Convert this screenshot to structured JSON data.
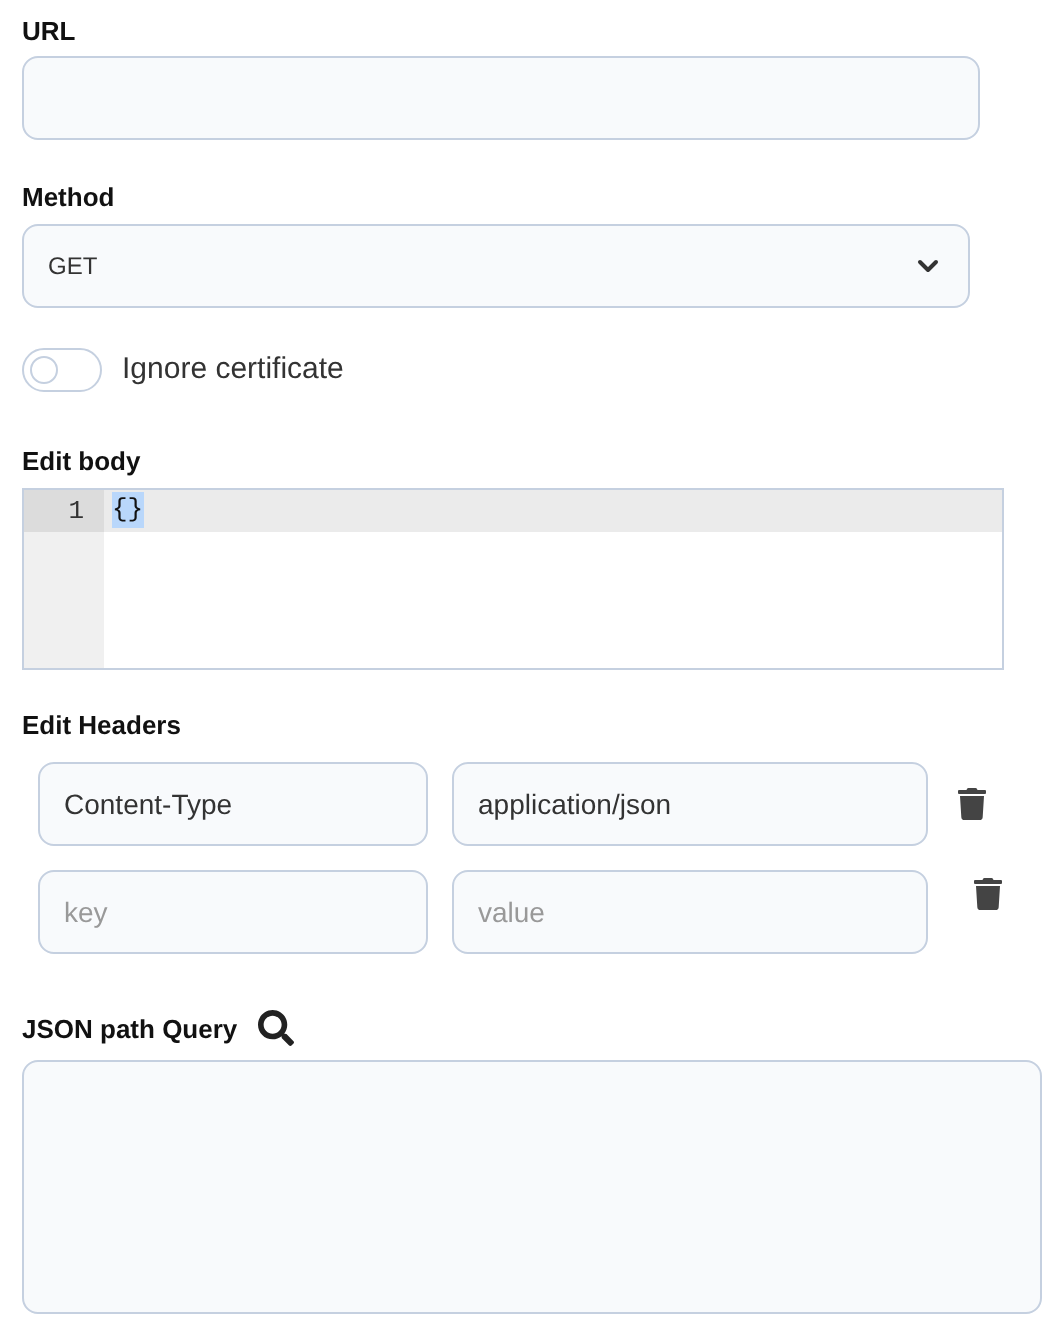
{
  "url": {
    "label": "URL"
  },
  "method": {
    "label": "Method",
    "value": "GET"
  },
  "ignore_certificate": {
    "label": "Ignore certificate",
    "on": false
  },
  "body": {
    "label": "Edit body",
    "lines": [
      {
        "number": "1",
        "text": "{}"
      }
    ]
  },
  "headers": {
    "label": "Edit Headers",
    "rows": [
      {
        "key": "Content-Type",
        "value": "application/json"
      },
      {
        "key_placeholder": "key",
        "value_placeholder": "value"
      }
    ]
  },
  "json_path_query": {
    "label": "JSON path Query"
  }
}
